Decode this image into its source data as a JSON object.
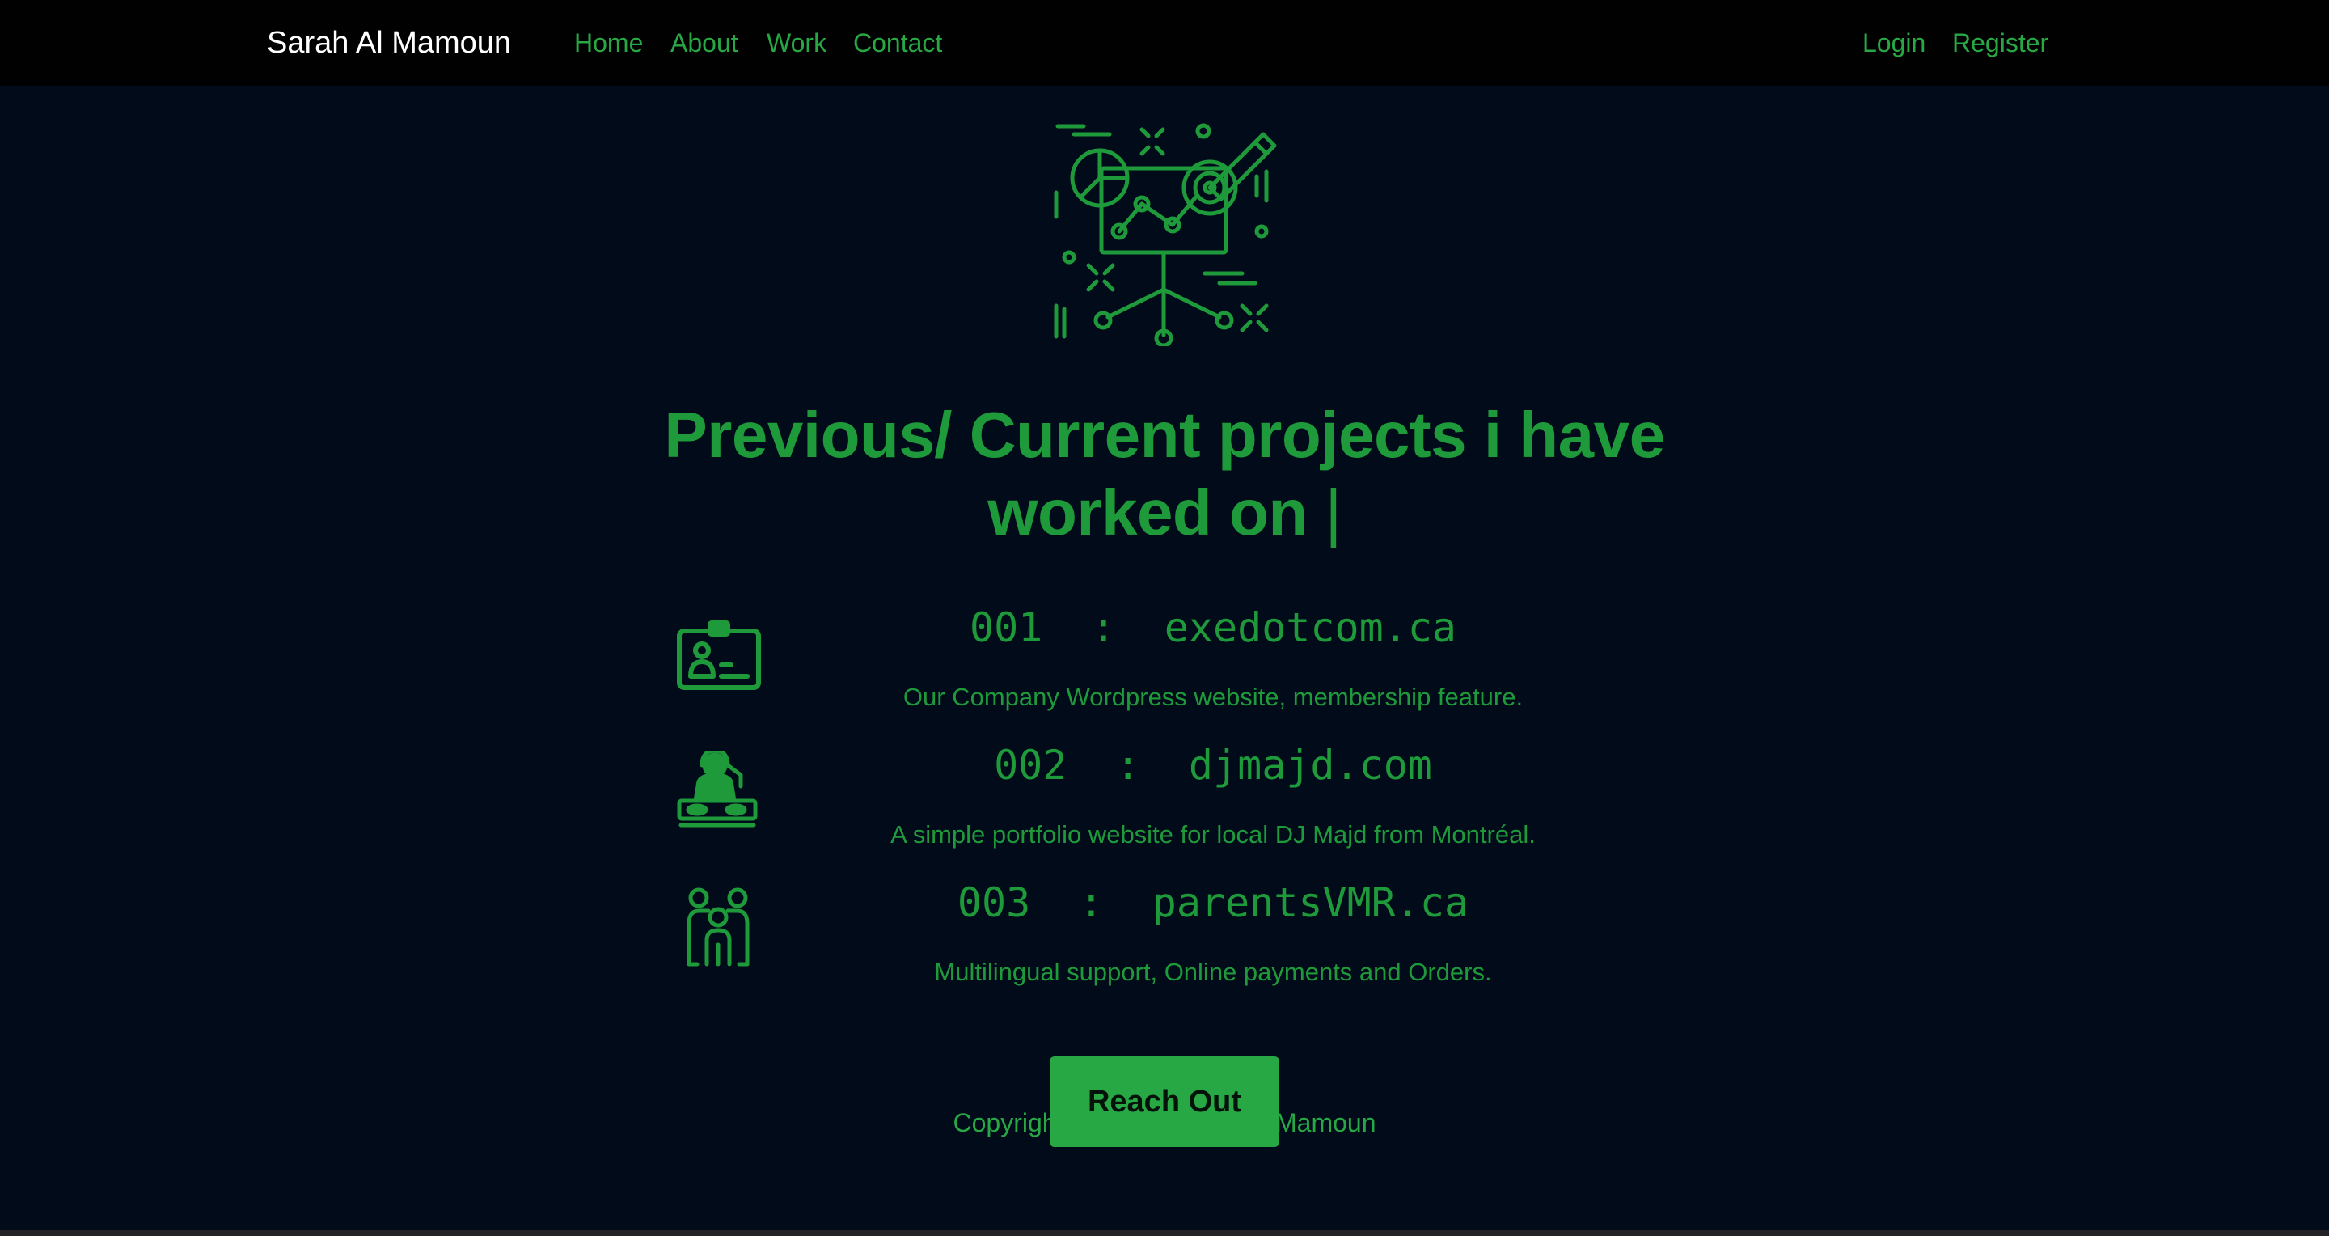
{
  "nav": {
    "brand": "Sarah Al Mamoun",
    "links": [
      "Home",
      "About",
      "Work",
      "Contact"
    ],
    "auth": [
      "Login",
      "Register"
    ]
  },
  "main": {
    "heading_line1": "Previous/ Current projects i have",
    "heading_line2": "worked on",
    "cursor": "|",
    "projects": [
      {
        "title": "001  :  exedotcom.ca",
        "description": "Our Company Wordpress website, membership feature.",
        "icon": "id-card-icon"
      },
      {
        "title": "002  :  djmajd.com",
        "description": "A simple portfolio website for local DJ Majd from Montréal.",
        "icon": "dj-turntable-icon"
      },
      {
        "title": "003  :  parentsVMR.ca",
        "description": "Multilingual support, Online payments and Orders.",
        "icon": "family-icon"
      }
    ],
    "cta_label": "Reach Out"
  },
  "footer": {
    "copyright": "Copyright 2020 by Sarah Al Mamoun"
  },
  "colors": {
    "accent": "#28a745",
    "text_green": "#1f9a3b",
    "background": "#020b1a",
    "navbar": "#010101"
  }
}
